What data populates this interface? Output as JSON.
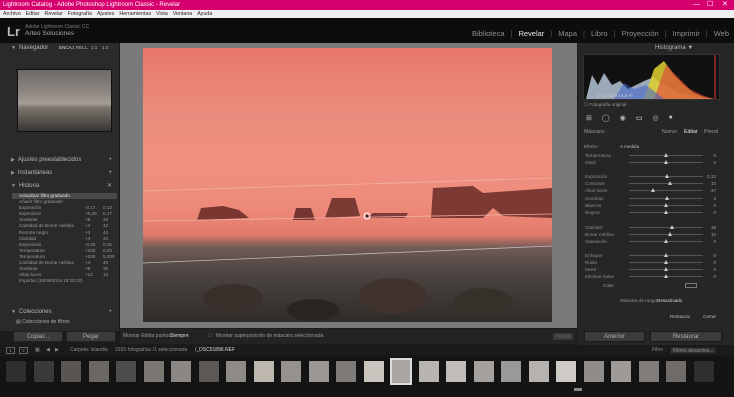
{
  "titlebar": {
    "text": "Lightroom Catalog - Adobe Photoshop Lightroom Classic - Revelar",
    "min": "—",
    "max": "☐",
    "close": "✕"
  },
  "menu": [
    "Archivo",
    "Editar",
    "Revelar",
    "Fotografía",
    "Ajustes",
    "Herramientas",
    "Vista",
    "Ventana",
    "Ayuda"
  ],
  "identity": {
    "logo": "Lr",
    "line1": "Adobe Lightroom Classic CC",
    "line2": "Arteo Soluciones"
  },
  "modules": [
    "Biblioteca",
    "Revelar",
    "Mapa",
    "Libro",
    "Proyección",
    "Imprimir",
    "Web"
  ],
  "active_module": "Revelar",
  "left": {
    "navigator": {
      "title": "Navegador",
      "zoom": [
        "ENCAJ.",
        "RELL.",
        "1:1",
        "1:4"
      ]
    },
    "presets": "Ajustes preestablecidos",
    "snapshots": "Instantáneas",
    "history": "Historia",
    "history_items": [
      {
        "label": "Actualizar filtro graduado",
        "v1": "",
        "v2": ""
      },
      {
        "label": "Añadir filtro graduado",
        "v1": "",
        "v2": ""
      },
      {
        "label": "Exposición",
        "v1": "-0,17",
        "v2": "0,12"
      },
      {
        "label": "Exposición",
        "v1": "+0,29",
        "v2": "0,17"
      },
      {
        "label": "Sombras",
        "v1": "+9",
        "v2": "33"
      },
      {
        "label": "Cantidad de Borrar neblina",
        "v1": "+4",
        "v2": "42"
      },
      {
        "label": "Recorte negro",
        "v1": "+3",
        "v2": "42"
      },
      {
        "label": "Claridad",
        "v1": "+4",
        "v2": "24"
      },
      {
        "label": "Exposición",
        "v1": "-0,20",
        "v2": "0,15"
      },
      {
        "label": "Temperatura",
        "v1": "+100",
        "v2": "0,03"
      },
      {
        "label": "Temperatura",
        "v1": "+200",
        "v2": "5.200"
      },
      {
        "label": "Cantidad de Borrar neblina",
        "v1": "+4",
        "v2": "40"
      },
      {
        "label": "Sombras",
        "v1": "+8",
        "v2": "36"
      },
      {
        "label": "Altas luces",
        "v1": "+12",
        "v2": "12"
      },
      {
        "label": "Importar (15/09/2019 19:25:22)",
        "v1": "",
        "v2": ""
      }
    ],
    "collections": "Colecciones",
    "collection_item": "Colecciones de filtros",
    "copy_label": "Copiar...",
    "paste_label": "Pegar"
  },
  "toolbar": {
    "show_edit_label": "Mostrar Editar puntos :",
    "show_edit_value": "Siempre",
    "overlay_label": "Mostrar superposición de máscara seleccionada",
    "done_label": "Hecho"
  },
  "right": {
    "histogram_title": "Histograma",
    "readout": "ƒ/ 11    13,0    14,5 %",
    "original_photo": "Fotografía original",
    "mask_label": "Máscara :",
    "mask_new": "Nuevo",
    "mask_edit": "Editar",
    "mask_brush": "Pincel",
    "effect_label": "Efecto :",
    "effect_value": "A medida",
    "sliders": [
      {
        "label": "Temperatura",
        "value": "0",
        "pos": 0.5
      },
      {
        "label": "Matiz",
        "value": "0",
        "pos": 0.5
      },
      {
        "label": "Exposición",
        "value": "0,12",
        "pos": 0.52
      },
      {
        "label": "Contraste",
        "value": "10",
        "pos": 0.55
      },
      {
        "label": "Altas luces",
        "value": "-37",
        "pos": 0.32
      },
      {
        "label": "Sombras",
        "value": "3",
        "pos": 0.51
      },
      {
        "label": "Blancos",
        "value": "0",
        "pos": 0.5
      },
      {
        "label": "Negros",
        "value": "0",
        "pos": 0.5
      },
      {
        "label": "Claridad",
        "value": "16",
        "pos": 0.58
      },
      {
        "label": "Borrar neblina",
        "value": "10",
        "pos": 0.55
      },
      {
        "label": "Saturación",
        "value": "0",
        "pos": 0.5
      },
      {
        "label": "Enfoque",
        "value": "0",
        "pos": 0.5
      },
      {
        "label": "Ruido",
        "value": "0",
        "pos": 0.5
      },
      {
        "label": "Moiré",
        "value": "0",
        "pos": 0.5
      },
      {
        "label": "Eliminar halos",
        "value": "0",
        "pos": 0.5
      }
    ],
    "color_label": "Color",
    "range_mask_label": "Máscara de rango :",
    "range_mask_value": "Desactivado",
    "reset_label": "Restaurar",
    "close_label": "Cerrar",
    "previous_label": "Anterior",
    "restore_label": "Restaurar"
  },
  "filmstrip": {
    "source": "Carpeta: Islandia",
    "count": "3155 fotografías /1 seleccionada",
    "file": "/_DSC51896.NEF",
    "filter_label": "Filtro :",
    "filter_value": "Filtros desactiva..."
  }
}
